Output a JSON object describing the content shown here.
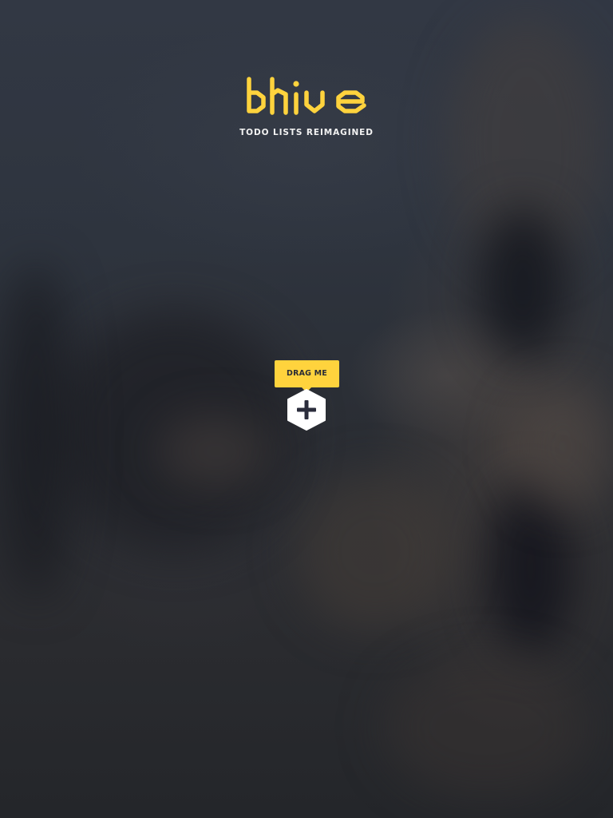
{
  "app": {
    "logo_text": "bhive",
    "tagline": "TODO LISTS REIMAGINED"
  },
  "onboarding": {
    "drag_hint": "DRAG ME",
    "add_button_icon": "plus-icon"
  },
  "colors": {
    "accent": "#ffd33d",
    "background": "#2a2e36",
    "tagline_text": "#f2f2f2",
    "button_fill": "#ffffff",
    "icon_dark": "#2b2d3c"
  }
}
